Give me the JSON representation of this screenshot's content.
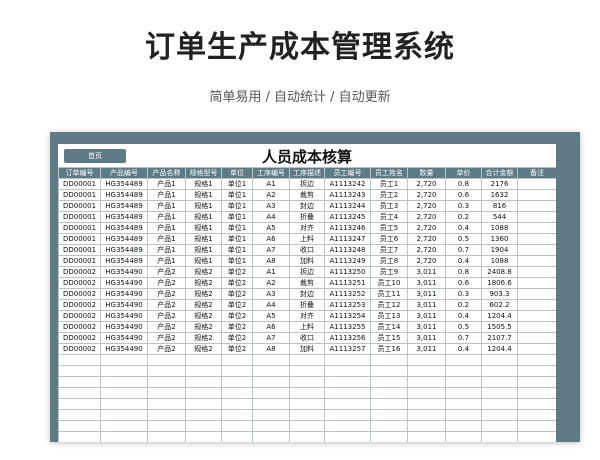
{
  "page": {
    "title": "订单生产成本管理系统",
    "subtitle": "简单易用 / 自动统计 / 自动更新"
  },
  "sheet": {
    "home_button": "首页",
    "title": "人员成本核算",
    "columns": [
      "订单编号",
      "产品编号",
      "产品名称",
      "规格型号",
      "单位",
      "工序编号",
      "工序描述",
      "员工编号",
      "员工姓名",
      "数量",
      "单价",
      "合计金额",
      "备注"
    ],
    "rows": [
      [
        "DD00001",
        "HG354489",
        "产品1",
        "规格1",
        "单位1",
        "A1",
        "拆边",
        "A1113242",
        "员工1",
        "2,720",
        "0.8",
        "2176",
        ""
      ],
      [
        "DD00001",
        "HG354489",
        "产品1",
        "规格1",
        "单位1",
        "A2",
        "裁剪",
        "A1113243",
        "员工2",
        "2,720",
        "0.6",
        "1632",
        ""
      ],
      [
        "DD00001",
        "HG354489",
        "产品1",
        "规格1",
        "单位1",
        "A3",
        "封边",
        "A1113244",
        "员工3",
        "2,720",
        "0.3",
        "816",
        ""
      ],
      [
        "DD00001",
        "HG354489",
        "产品1",
        "规格1",
        "单位1",
        "A4",
        "折叠",
        "A1113245",
        "员工4",
        "2,720",
        "0.2",
        "544",
        ""
      ],
      [
        "DD00001",
        "HG354489",
        "产品1",
        "规格1",
        "单位1",
        "A5",
        "对齐",
        "A1113246",
        "员工5",
        "2,720",
        "0.4",
        "1088",
        ""
      ],
      [
        "DD00001",
        "HG354489",
        "产品1",
        "规格1",
        "单位1",
        "A6",
        "上料",
        "A1113247",
        "员工6",
        "2,720",
        "0.5",
        "1360",
        ""
      ],
      [
        "DD00001",
        "HG354489",
        "产品1",
        "规格1",
        "单位1",
        "A7",
        "收口",
        "A1113248",
        "员工7",
        "2,720",
        "0.7",
        "1904",
        ""
      ],
      [
        "DD00001",
        "HG354489",
        "产品1",
        "规格1",
        "单位1",
        "A8",
        "加料",
        "A1113249",
        "员工8",
        "2,720",
        "0.4",
        "1088",
        ""
      ],
      [
        "DD00002",
        "HG354490",
        "产品2",
        "规格2",
        "单位2",
        "A1",
        "拆边",
        "A1113250",
        "员工9",
        "3,011",
        "0.8",
        "2408.8",
        ""
      ],
      [
        "DD00002",
        "HG354490",
        "产品2",
        "规格2",
        "单位2",
        "A2",
        "裁剪",
        "A1113251",
        "员工10",
        "3,011",
        "0.6",
        "1806.6",
        ""
      ],
      [
        "DD00002",
        "HG354490",
        "产品2",
        "规格2",
        "单位2",
        "A3",
        "封边",
        "A1113252",
        "员工11",
        "3,011",
        "0.3",
        "903.3",
        ""
      ],
      [
        "DD00002",
        "HG354490",
        "产品2",
        "规格2",
        "单位2",
        "A4",
        "折叠",
        "A1113253",
        "员工12",
        "3,011",
        "0.2",
        "602.2",
        ""
      ],
      [
        "DD00002",
        "HG354490",
        "产品2",
        "规格2",
        "单位2",
        "A5",
        "对齐",
        "A1113254",
        "员工13",
        "3,011",
        "0.4",
        "1204.4",
        ""
      ],
      [
        "DD00002",
        "HG354490",
        "产品2",
        "规格2",
        "单位2",
        "A6",
        "上料",
        "A1113255",
        "员工14",
        "3,011",
        "0.5",
        "1505.5",
        ""
      ],
      [
        "DD00002",
        "HG354490",
        "产品2",
        "规格2",
        "单位2",
        "A7",
        "收口",
        "A1113256",
        "员工15",
        "3,011",
        "0.7",
        "2107.7",
        ""
      ],
      [
        "DD00002",
        "HG354490",
        "产品2",
        "规格2",
        "单位2",
        "A8",
        "加料",
        "A1113257",
        "员工16",
        "3,011",
        "0.4",
        "1204.4",
        ""
      ]
    ],
    "empty_rows": 9
  },
  "colors": {
    "accent": "#5d7a85",
    "grid": "#b9c2c6"
  }
}
